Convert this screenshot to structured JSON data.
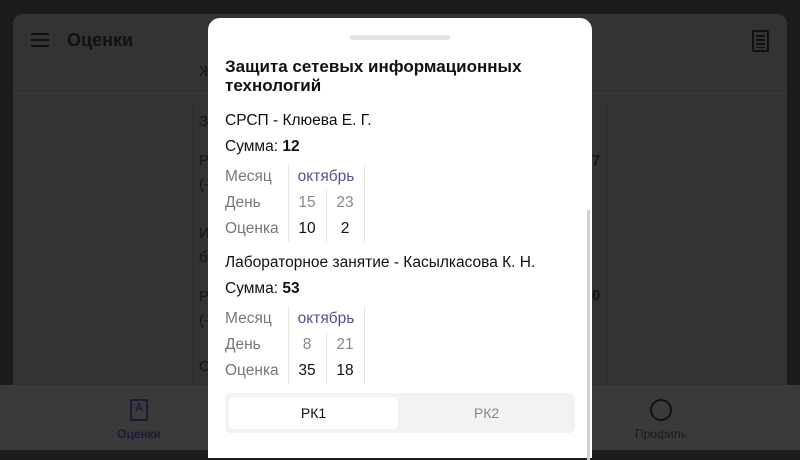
{
  "header": {
    "title": "Оценки",
    "menu_icon": "menu-icon",
    "calc_icon": "calculator-icon"
  },
  "background_fragments": [
    "Ж",
    "З",
    "Р",
    "(-",
    "И",
    "б",
    "Р",
    "(-",
    "С",
    "7",
    "0"
  ],
  "nav": {
    "grades": "Оценки",
    "profile": "Профиль"
  },
  "modal": {
    "title": "Защита сетевых информационных технологий",
    "sections": [
      {
        "name": "СРСП - Клюева Е. Г.",
        "sum_label": "Сумма: ",
        "sum": "12",
        "month_label": "Месяц",
        "month": "октябрь",
        "day_label": "День",
        "days": [
          "15",
          "23"
        ],
        "grade_label": "Оценка",
        "grades": [
          "10",
          "2"
        ]
      },
      {
        "name": "Лабораторное занятие - Касылкасова К. Н.",
        "sum_label": "Сумма: ",
        "sum": "53",
        "month_label": "Месяц",
        "month": "октябрь",
        "day_label": "День",
        "days": [
          "8",
          "21"
        ],
        "grade_label": "Оценка",
        "grades": [
          "35",
          "18"
        ]
      }
    ],
    "tabs": [
      "РК1",
      "РК2"
    ],
    "selected_tab": "РК1"
  }
}
